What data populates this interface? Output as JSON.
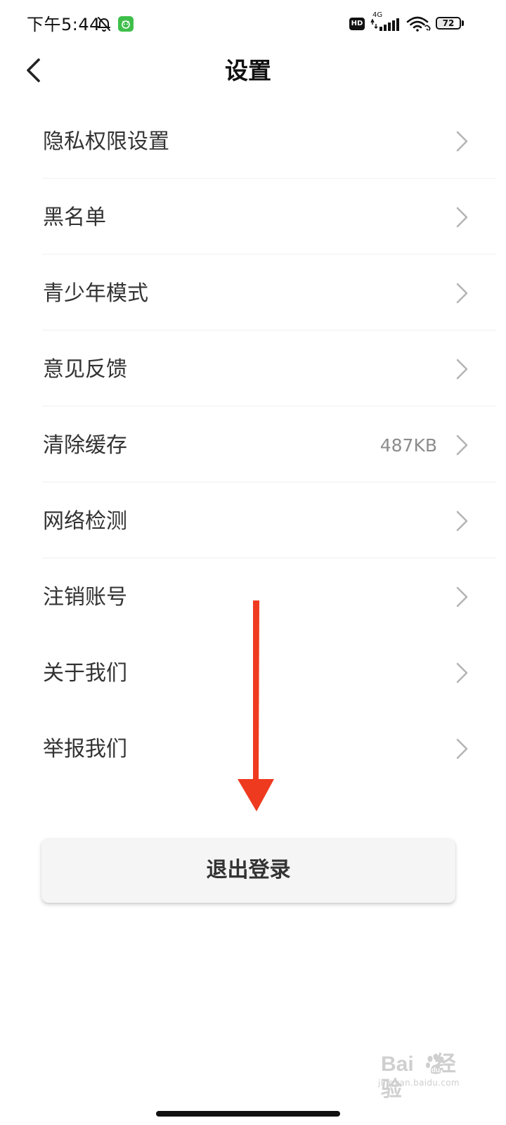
{
  "status_bar": {
    "time": "下午5:44",
    "hd_badge": "HD",
    "network_type": "4G",
    "battery_level": "72",
    "battery_fraction": 0.72,
    "icons": [
      "bell-muted-icon",
      "app-notification-icon",
      "signal-icon",
      "wifi-icon",
      "battery-icon"
    ]
  },
  "header": {
    "title": "设置",
    "back_icon": "chevron-left-icon"
  },
  "settings": {
    "items": [
      {
        "label": "隐私权限设置",
        "value": ""
      },
      {
        "label": "黑名单",
        "value": ""
      },
      {
        "label": "青少年模式",
        "value": ""
      },
      {
        "label": "意见反馈",
        "value": ""
      },
      {
        "label": "清除缓存",
        "value": "487KB"
      },
      {
        "label": "网络检测",
        "value": ""
      },
      {
        "label": "注销账号",
        "value": ""
      },
      {
        "label": "关于我们",
        "value": ""
      },
      {
        "label": "举报我们",
        "value": ""
      }
    ]
  },
  "logout": {
    "label": "退出登录"
  },
  "annotation": {
    "arrow_color": "#ee3a1f"
  },
  "watermark": {
    "brand": "Bai",
    "brand_suffix": "经验",
    "url": "jingyan.baidu.com"
  },
  "colors": {
    "background": "#ffffff",
    "text_primary": "#333333",
    "text_secondary": "#8c8c8c",
    "chevron": "#b4b4b4",
    "divider": "#f0f0f0",
    "logout_bg": "#f5f5f5"
  }
}
